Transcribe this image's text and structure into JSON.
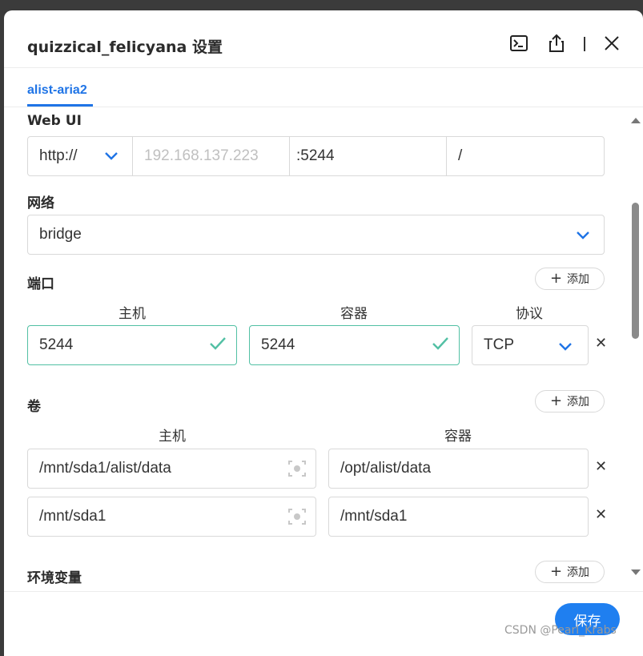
{
  "dialog": {
    "title": "quizzical_felicyana 设置",
    "icons": [
      "terminal-icon",
      "share-icon",
      "close-icon"
    ]
  },
  "tabs": [
    {
      "label": "alist-aria2",
      "active": true
    }
  ],
  "webui": {
    "label": "Web UI",
    "protocol": "http://",
    "host_placeholder": "192.168.137.223",
    "port": ":5244",
    "path": "/"
  },
  "network": {
    "label": "网络",
    "value": "bridge"
  },
  "ports": {
    "label": "端口",
    "add_label": "添加",
    "headers": {
      "host": "主机",
      "container": "容器",
      "protocol": "协议"
    },
    "rows": [
      {
        "host": "5244",
        "container": "5244",
        "protocol": "TCP"
      }
    ]
  },
  "volumes": {
    "label": "卷",
    "add_label": "添加",
    "headers": {
      "host": "主机",
      "container": "容器"
    },
    "rows": [
      {
        "host": "/mnt/sda1/alist/data",
        "container": "/opt/alist/data"
      },
      {
        "host": "/mnt/sda1",
        "container": "/mnt/sda1"
      }
    ]
  },
  "env": {
    "label": "环境变量",
    "add_label": "添加"
  },
  "footer": {
    "save_label": "保存"
  },
  "watermark": "CSDN @Pearl_Krabs",
  "colors": {
    "accent": "#1f74e6",
    "valid": "#52c0a4",
    "save": "#1f7ff0"
  }
}
